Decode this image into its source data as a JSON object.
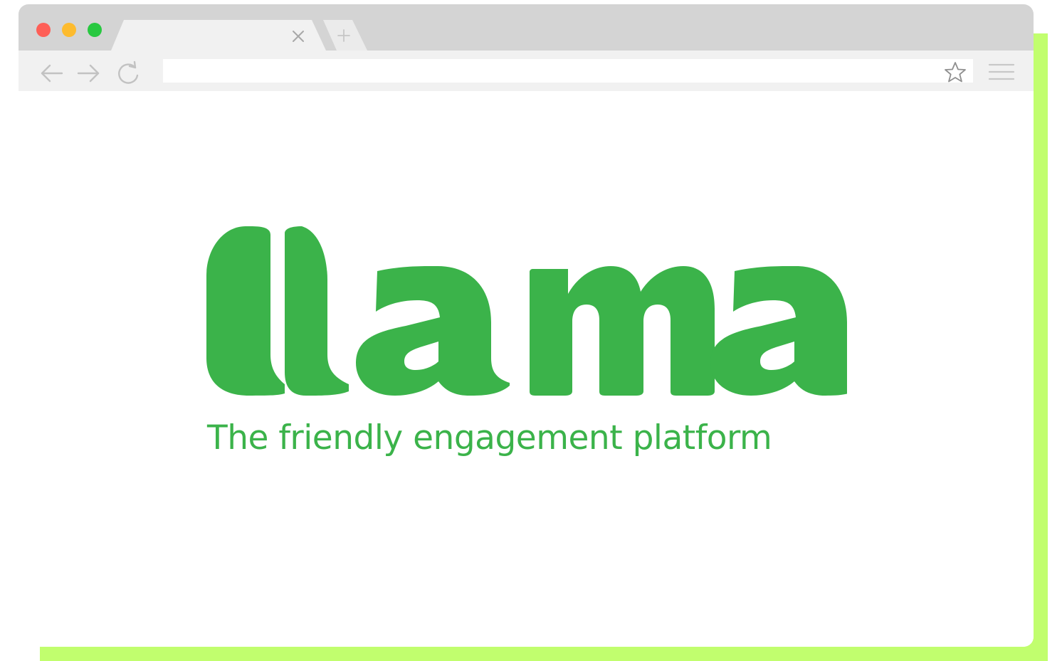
{
  "colors": {
    "accent_backdrop": "#c1fe6e",
    "brand_green": "#3bb34a",
    "tab_strip": "#d4d4d4",
    "toolbar": "#f1f1f1",
    "traffic_close": "#fe5f57",
    "traffic_minimize": "#fdbb2e",
    "traffic_maximize": "#28c840"
  },
  "browser": {
    "traffic_lights": [
      "close",
      "minimize",
      "maximize"
    ],
    "active_tab": {
      "title": "",
      "close_icon": "close-icon"
    },
    "new_tab_icon": "plus-icon",
    "toolbar": {
      "back_icon": "arrow-left-icon",
      "forward_icon": "arrow-right-icon",
      "reload_icon": "reload-icon",
      "address_value": "",
      "bookmark_icon": "star-icon",
      "menu_icon": "hamburger-menu-icon"
    }
  },
  "page": {
    "logo_text": "llama",
    "tagline": "The friendly engagement platform"
  }
}
